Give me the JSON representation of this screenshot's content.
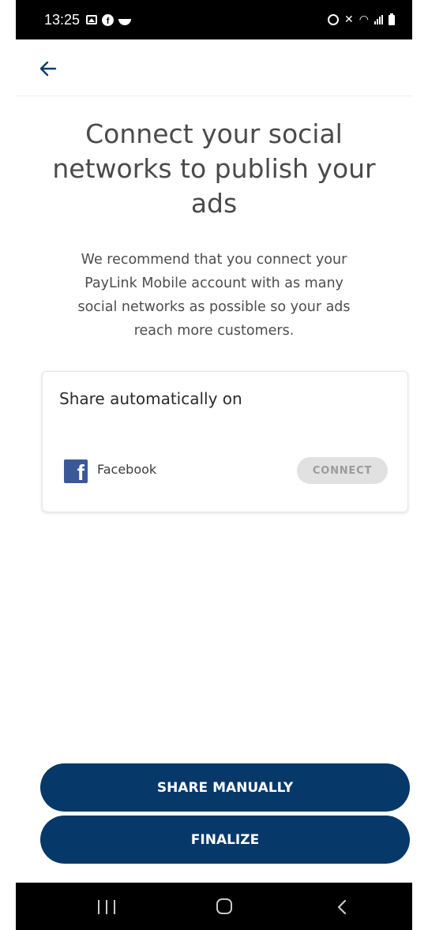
{
  "status_bar": {
    "time": "13:25",
    "left_icons": [
      "gallery-icon",
      "facebook-icon",
      "bowl-icon"
    ],
    "right_icons": [
      "alarm-icon",
      "mute-icon",
      "wifi-icon",
      "signal-icon",
      "battery-icon"
    ]
  },
  "header": {
    "back_icon": "arrow-left-icon"
  },
  "main": {
    "title": "Connect your social networks to publish your ads",
    "subtitle": "We recommend that you connect your PayLink Mobile account with as many social networks as possible so your ads reach more customers."
  },
  "card": {
    "heading": "Share automatically on",
    "networks": [
      {
        "icon": "facebook-logo-icon",
        "label": "Facebook",
        "button_label": "CONNECT"
      }
    ]
  },
  "actions": {
    "share_manually_label": "SHARE MANUALLY",
    "finalize_label": "FINALIZE"
  },
  "nav_bar": {
    "icons": [
      "recent-apps-icon",
      "home-icon",
      "back-icon"
    ]
  },
  "colors": {
    "primary": "#07386a",
    "facebook": "#3b5998",
    "disabled_button_bg": "#e1e1e1",
    "disabled_button_text": "#9b9b9b",
    "back_arrow": "#0a3d6e"
  }
}
